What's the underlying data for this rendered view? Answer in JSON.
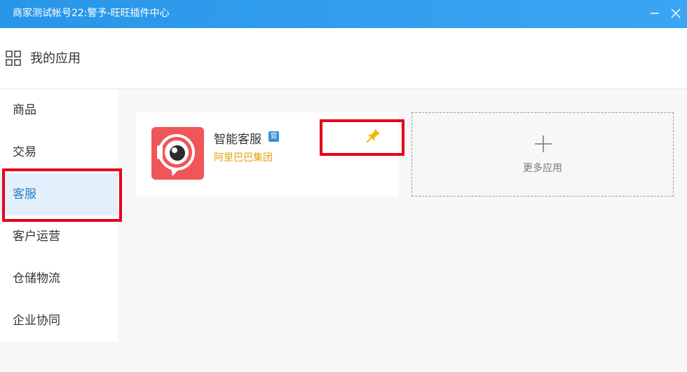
{
  "window": {
    "title": "商家测试帐号22:警予-旺旺插件中心",
    "minimize_icon": "minimize-icon",
    "close_icon": "close-icon"
  },
  "header": {
    "icon": "apps-grid-icon",
    "title": "我的应用"
  },
  "sidebar": {
    "items": [
      {
        "label": "商品",
        "active": false
      },
      {
        "label": "交易",
        "active": false
      },
      {
        "label": "客服",
        "active": true
      },
      {
        "label": "客户运营",
        "active": false
      },
      {
        "label": "仓储物流",
        "active": false
      },
      {
        "label": "企业协同",
        "active": false
      }
    ]
  },
  "apps": [
    {
      "name": "智能客服",
      "badge": "官",
      "vendor": "阿里巴巴集团",
      "icon": "smart-service-eye-icon",
      "pin_icon": "pin-icon",
      "pinned": true
    }
  ],
  "more_apps": {
    "icon": "plus-icon",
    "label": "更多应用"
  },
  "colors": {
    "titlebar": "#2896e8",
    "active_item_bg": "#e3effb",
    "active_item_text": "#2a7fc8",
    "app_icon_bg": "#ee5658",
    "vendor_text": "#e2a10e",
    "pin": "#f5b800",
    "highlight_box": "#e3001b"
  }
}
